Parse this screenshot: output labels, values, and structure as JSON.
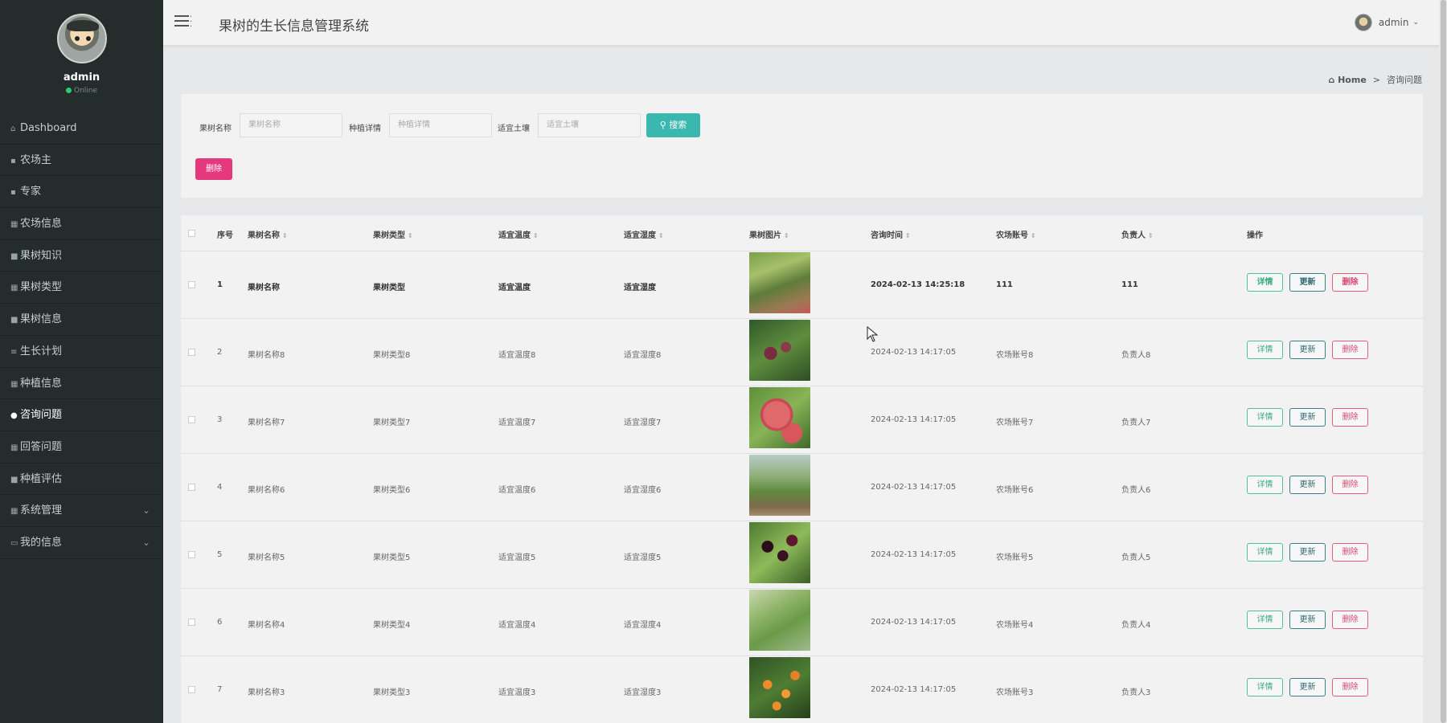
{
  "app": {
    "title": "果树的生长信息管理系统",
    "user": "admin"
  },
  "sidebar": {
    "profile_name": "admin",
    "profile_status": "Online",
    "items": [
      {
        "label": "Dashboard",
        "icon": "home-icon"
      },
      {
        "label": "农场主",
        "icon": "user-icon"
      },
      {
        "label": "专家",
        "icon": "user-icon"
      },
      {
        "label": "农场信息",
        "icon": "grid-icon"
      },
      {
        "label": "果树知识",
        "icon": "book-icon"
      },
      {
        "label": "果树类型",
        "icon": "grid-icon"
      },
      {
        "label": "果树信息",
        "icon": "book-icon"
      },
      {
        "label": "生长计划",
        "icon": "list-icon"
      },
      {
        "label": "种植信息",
        "icon": "grid-icon"
      },
      {
        "label": "咨询问题",
        "icon": "pin-icon"
      },
      {
        "label": "回答问题",
        "icon": "grid-icon"
      },
      {
        "label": "种植评估",
        "icon": "book-icon"
      },
      {
        "label": "系统管理",
        "icon": "grid-icon"
      },
      {
        "label": "我的信息",
        "icon": "card-icon"
      }
    ]
  },
  "breadcrumb": {
    "home": "Home",
    "separator": ">",
    "current": "咨询问题"
  },
  "search": {
    "fields": [
      {
        "label": "果树名称",
        "placeholder": "果树名称"
      },
      {
        "label": "种植详情",
        "placeholder": "种植详情"
      },
      {
        "label": "适宜土壤",
        "placeholder": "适宜土壤"
      }
    ],
    "search_button": "搜索",
    "delete_button": "删除"
  },
  "table": {
    "headers": [
      "序号",
      "果树名称",
      "果树类型",
      "适宜温度",
      "适宜湿度",
      "果树图片",
      "咨询时间",
      "农场账号",
      "负责人",
      "操作"
    ],
    "actions": {
      "detail": "详情",
      "update": "更新",
      "delete": "删除"
    },
    "rows": [
      {
        "no": "1",
        "name": "果树名称",
        "type": "果树类型",
        "temp": "适宜温度",
        "hum": "适宜湿度",
        "time": "2024-02-13 14:25:18",
        "account": "111",
        "owner": "111"
      },
      {
        "no": "2",
        "name": "果树名称8",
        "type": "果树类型8",
        "temp": "适宜温度8",
        "hum": "适宜湿度8",
        "time": "2024-02-13 14:17:05",
        "account": "农场账号8",
        "owner": "负责人8"
      },
      {
        "no": "3",
        "name": "果树名称7",
        "type": "果树类型7",
        "temp": "适宜温度7",
        "hum": "适宜湿度7",
        "time": "2024-02-13 14:17:05",
        "account": "农场账号7",
        "owner": "负责人7"
      },
      {
        "no": "4",
        "name": "果树名称6",
        "type": "果树类型6",
        "temp": "适宜温度6",
        "hum": "适宜湿度6",
        "time": "2024-02-13 14:17:05",
        "account": "农场账号6",
        "owner": "负责人6"
      },
      {
        "no": "5",
        "name": "果树名称5",
        "type": "果树类型5",
        "temp": "适宜温度5",
        "hum": "适宜湿度5",
        "time": "2024-02-13 14:17:05",
        "account": "农场账号5",
        "owner": "负责人5"
      },
      {
        "no": "6",
        "name": "果树名称4",
        "type": "果树类型4",
        "temp": "适宜温度4",
        "hum": "适宜湿度4",
        "time": "2024-02-13 14:17:05",
        "account": "农场账号4",
        "owner": "负责人4"
      },
      {
        "no": "7",
        "name": "果树名称3",
        "type": "果树类型3",
        "temp": "适宜温度3",
        "hum": "适宜湿度3",
        "time": "2024-02-13 14:17:05",
        "account": "农场账号3",
        "owner": "负责人3"
      }
    ]
  },
  "colors": {
    "sidebar_bg": "#252d2c",
    "search_button": "#3ab8b0",
    "delete_button": "#e5397d",
    "detail_border": "#4fbf9f",
    "update_border": "#3a7f86",
    "delete_border": "#e35b7f"
  }
}
